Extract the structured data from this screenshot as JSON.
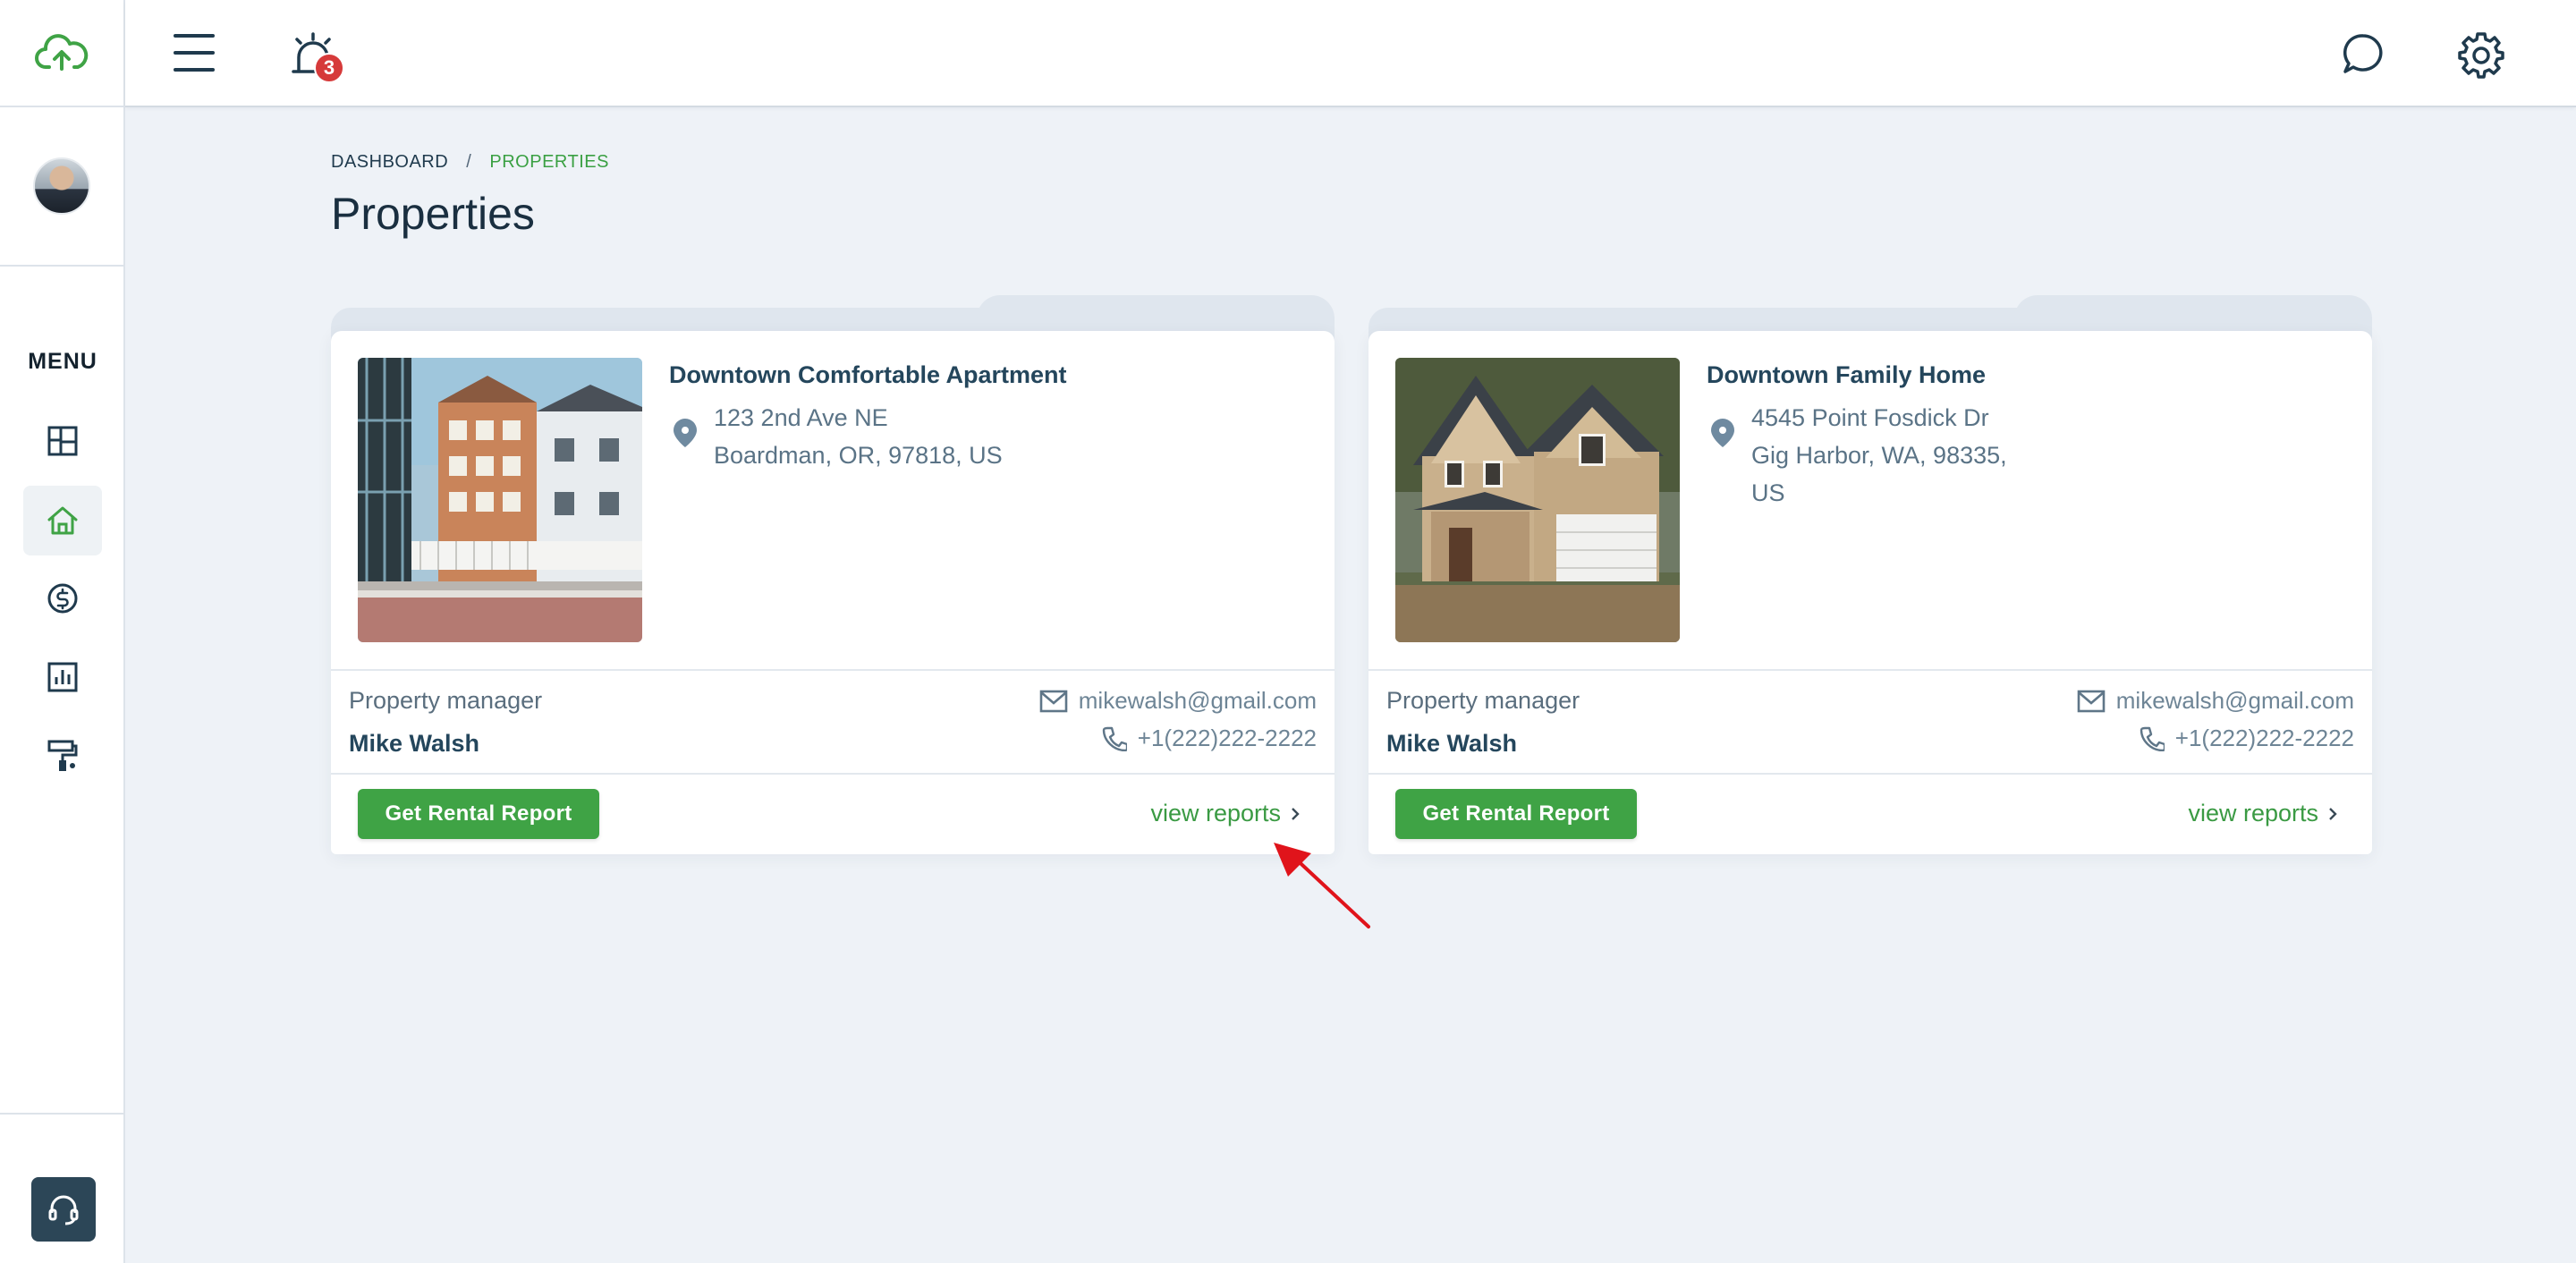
{
  "sidebar": {
    "menu_title": "MENU",
    "items": [
      {
        "icon": "dashboard-icon",
        "active": false
      },
      {
        "icon": "home-icon",
        "active": true
      },
      {
        "icon": "dollar-icon",
        "active": false
      },
      {
        "icon": "chart-icon",
        "active": false
      },
      {
        "icon": "paint-roller-icon",
        "active": false
      }
    ],
    "support_icon": "headset-icon"
  },
  "header": {
    "notification_count": "3",
    "right_icons": [
      "chat-icon",
      "gear-icon"
    ]
  },
  "breadcrumb": {
    "root": "DASHBOARD",
    "separator": "/",
    "current": "PROPERTIES"
  },
  "page_title": "Properties",
  "properties": [
    {
      "name": "Downtown Comfortable Apartment",
      "address_line1": "123 2nd Ave NE",
      "address_line2": "Boardman, OR, 97818, US",
      "address_line3": "",
      "manager_label": "Property manager",
      "manager_name": "Mike Walsh",
      "email": "mikewalsh@gmail.com",
      "phone": "+1(222)222-2222",
      "button_label": "Get Rental Report",
      "link_label": "view reports"
    },
    {
      "name": "Downtown Family Home",
      "address_line1": "4545 Point Fosdick Dr",
      "address_line2": "Gig Harbor, WA, 98335,",
      "address_line3": "US",
      "manager_label": "Property manager",
      "manager_name": "Mike Walsh",
      "email": "mikewalsh@gmail.com",
      "phone": "+1(222)222-2222",
      "button_label": "Get Rental Report",
      "link_label": "view reports"
    }
  ],
  "colors": {
    "accent_green": "#3fa345",
    "badge_red": "#d63a3a",
    "annotation_red": "#e0141b"
  }
}
